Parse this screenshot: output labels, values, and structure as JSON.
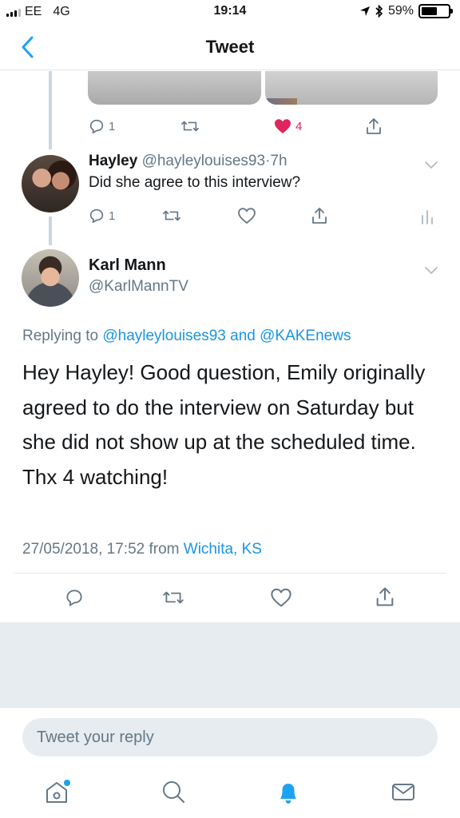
{
  "status_bar": {
    "carrier": "EE",
    "network": "4G",
    "time": "19:14",
    "battery_percent_label": "59%",
    "battery_level": 0.59
  },
  "nav": {
    "title": "Tweet",
    "back_icon": "chevron-left-icon"
  },
  "parent_tweet": {
    "reply_count": "1",
    "like_count": "4",
    "liked": true
  },
  "reply_tweet": {
    "name": "Hayley",
    "handle": "@hayleylouises93",
    "separator": "·",
    "time": "7h",
    "text": "Did she agree to this interview?",
    "reply_count": "1"
  },
  "main_tweet": {
    "name": "Karl Mann",
    "handle": "@KarlMannTV",
    "replying_prefix": "Replying to ",
    "replying_user1": "@hayleylouises93",
    "replying_and": " and ",
    "replying_user2": "@KAKEnews",
    "body": "Hey Hayley! Good question, Emily originally agreed to do the interview on Saturday but she did not show up at the scheduled time.\nThx 4 watching!",
    "date": "27/05/2018, 17:52",
    "from": " from ",
    "location": "Wichita, KS"
  },
  "reply_bar": {
    "placeholder": "Tweet your reply"
  },
  "tabs": [
    "home-icon",
    "search-icon",
    "notifications-icon",
    "messages-icon"
  ],
  "colors": {
    "accent": "#1da1f2",
    "link": "#1b95e0",
    "like": "#e0245e",
    "muted": "#657786",
    "background_gray": "#e6ecf0"
  }
}
